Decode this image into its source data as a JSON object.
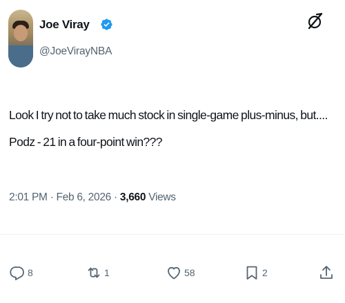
{
  "author": {
    "display_name": "Joe Viray",
    "handle": "@JoeVirayNBA",
    "verified": true,
    "verified_color": "#1d9bf0"
  },
  "post": {
    "text": "Look I try not to take much stock in single-game plus-minus, but.... Podz - 21 in a four-point win???",
    "time": "2:01 PM",
    "date": "Feb 6, 2026",
    "separator": "·",
    "views_count": "3,660",
    "views_label": "Views"
  },
  "actions": {
    "reply_count": "8",
    "repost_count": "1",
    "like_count": "58",
    "bookmark_count": "2"
  },
  "icons": {
    "grok": "grok-icon",
    "reply": "reply-icon",
    "repost": "repost-icon",
    "like": "heart-icon",
    "bookmark": "bookmark-icon",
    "share": "share-icon"
  },
  "colors": {
    "text_primary": "#0f1419",
    "text_secondary": "#536471",
    "divider": "#eff3f4"
  }
}
